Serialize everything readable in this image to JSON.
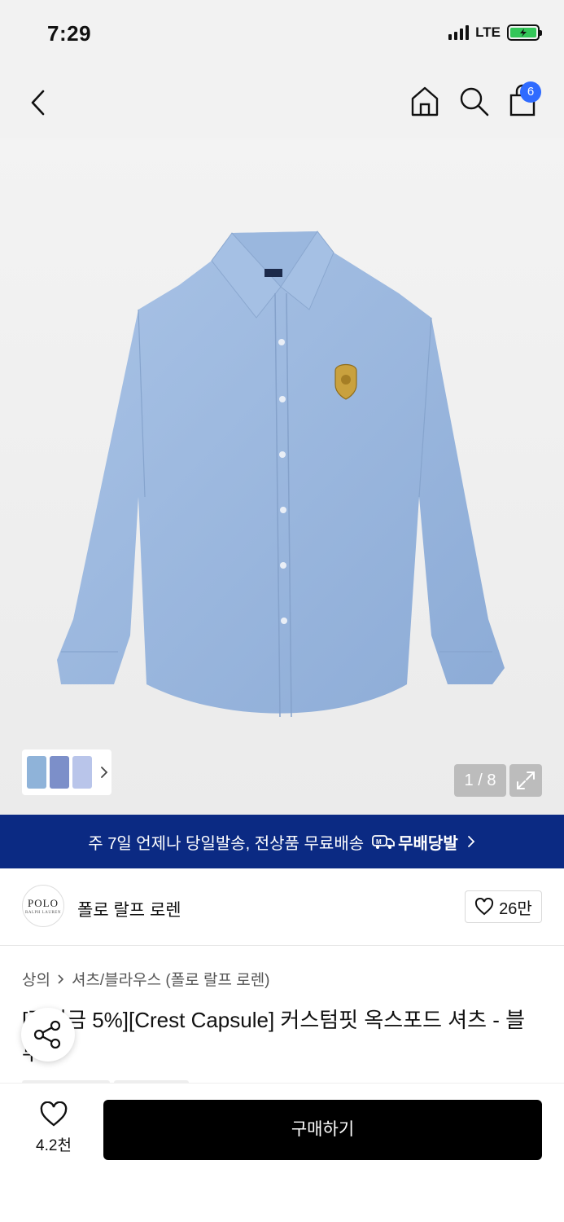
{
  "status_bar": {
    "time": "7:29",
    "network": "LTE",
    "battery_color": "#34c759"
  },
  "nav": {
    "back_icon": "chevron-left-icon",
    "home_icon": "home-icon",
    "search_icon": "search-icon",
    "bag_icon": "shopping-bag-icon",
    "bag_count": "6"
  },
  "gallery": {
    "counter": "1 / 8",
    "expand_icon": "expand-icon",
    "thumbnail_colors": [
      "#8fb3d9",
      "#7c8fc9",
      "#b9c5ea"
    ]
  },
  "banner": {
    "text": "주 7일 언제나 당일발송, 전상품 무료배송",
    "badge_label": "무배당발",
    "background": "#0b2a83"
  },
  "brand": {
    "logo_text": "POLO",
    "logo_subtext": "RALPH LAUREN",
    "name": "폴로 랄프 로렌",
    "likes": "26만"
  },
  "breadcrumb": {
    "category": "상의",
    "subcategory": "셔츠/블라우스 (폴로 랄프 로렌)"
  },
  "product": {
    "title": "[적립금 5%][Crest Capsule] 커스텀핏 옥스포드 셔츠 - 블루"
  },
  "bottom_bar": {
    "wish_count": "4.2천",
    "buy_label": "구매하기"
  }
}
